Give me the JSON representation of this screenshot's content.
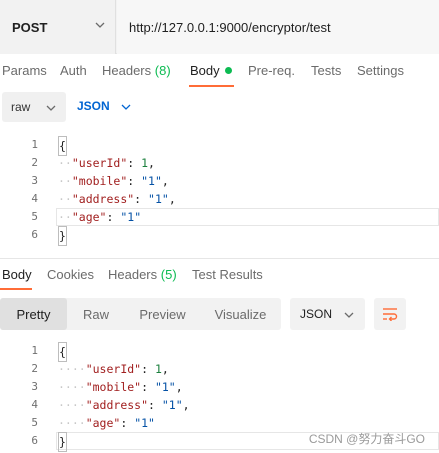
{
  "request": {
    "method": "POST",
    "url": "http://127.0.0.1:9000/encryptor/test"
  },
  "request_tabs": [
    {
      "label": "Params"
    },
    {
      "label": "Auth"
    },
    {
      "label": "Headers",
      "count": "(8)"
    },
    {
      "label": "Body",
      "active": true
    },
    {
      "label": "Pre-req."
    },
    {
      "label": "Tests"
    },
    {
      "label": "Settings"
    }
  ],
  "body_options": {
    "mode": "raw",
    "language": "JSON"
  },
  "request_body": {
    "line_numbers": [
      "1",
      "2",
      "3",
      "4",
      "5",
      "6"
    ],
    "lines": [
      "{",
      "  \"userId\": 1,",
      "  \"mobile\": \"1\",",
      "  \"address\": \"1\",",
      "  \"age\": \"1\"",
      "}"
    ]
  },
  "response_tabs": [
    {
      "label": "Body",
      "active": true
    },
    {
      "label": "Cookies"
    },
    {
      "label": "Headers",
      "count": "(5)"
    },
    {
      "label": "Test Results"
    }
  ],
  "response_view": {
    "modes": [
      "Pretty",
      "Raw",
      "Preview",
      "Visualize"
    ],
    "active_mode": "Pretty",
    "format": "JSON"
  },
  "response_body": {
    "line_numbers": [
      "1",
      "2",
      "3",
      "4",
      "5",
      "6"
    ],
    "lines": [
      "{",
      "    \"userId\": 1,",
      "    \"mobile\": \"1\",",
      "    \"address\": \"1\",",
      "    \"age\": \"1\"",
      "}"
    ]
  },
  "watermark": "CSDN @努力奋斗GO",
  "colors": {
    "accent": "#ff6c37",
    "green": "#0cbb52",
    "json_blue": "#0265d2"
  }
}
